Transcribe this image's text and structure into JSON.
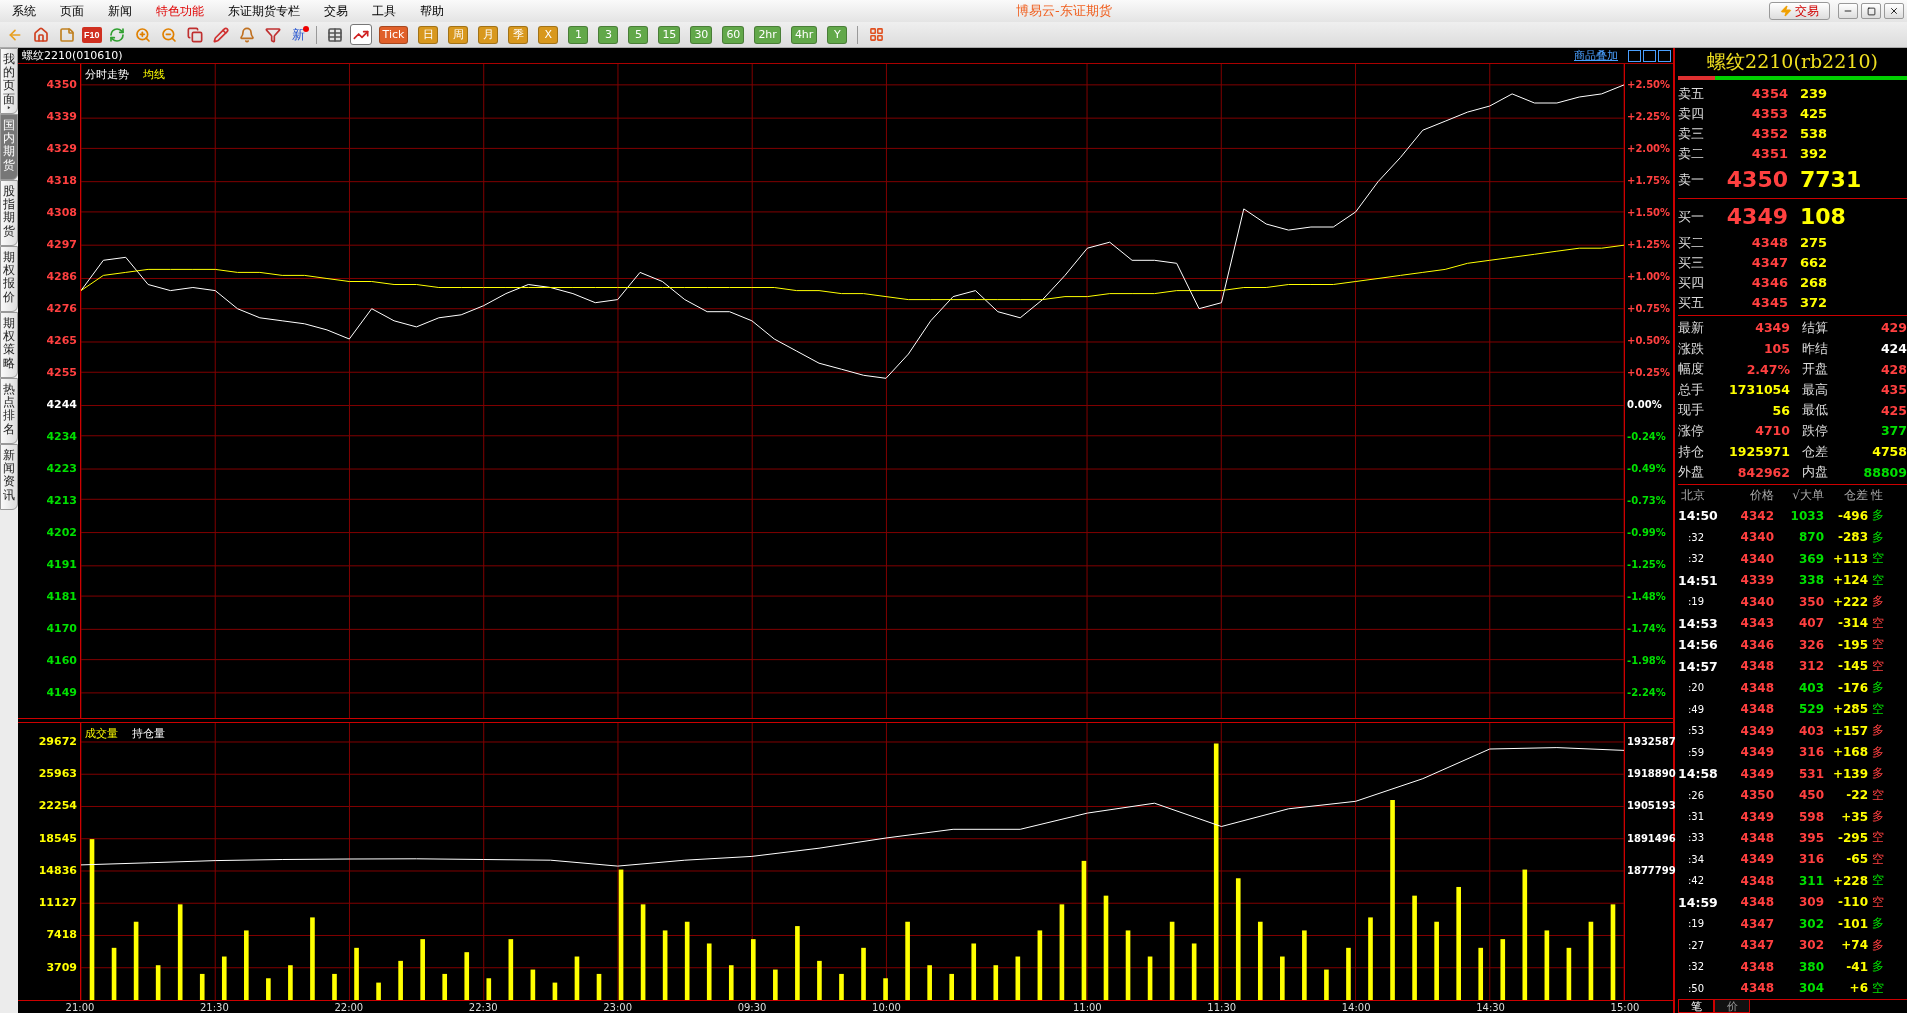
{
  "menu": [
    {
      "label": "系统",
      "highlighted": false
    },
    {
      "label": "页面",
      "highlighted": false
    },
    {
      "label": "新闻",
      "highlighted": false
    },
    {
      "label": "特色功能",
      "highlighted": true
    },
    {
      "label": "东证期货专栏",
      "highlighted": false
    },
    {
      "label": "交易",
      "highlighted": false
    },
    {
      "label": "工具",
      "highlighted": false
    },
    {
      "label": "帮助",
      "highlighted": false
    }
  ],
  "window": {
    "title": "博易云-东证期货",
    "trade_button": "交易"
  },
  "toolbar": {
    "f10": "F10",
    "news": "新",
    "views": [
      {
        "selected": false
      },
      {
        "selected": true
      }
    ],
    "periods": [
      {
        "label": "Tick",
        "color": "#e0602a"
      },
      {
        "label": "日",
        "color": "#d8981e"
      },
      {
        "label": "周",
        "color": "#d8981e"
      },
      {
        "label": "月",
        "color": "#d8981e"
      },
      {
        "label": "季",
        "color": "#d8981e"
      },
      {
        "label": "X",
        "color": "#d8981e"
      },
      {
        "label": "1",
        "color": "#62a84a"
      },
      {
        "label": "3",
        "color": "#62a84a"
      },
      {
        "label": "5",
        "color": "#62a84a"
      },
      {
        "label": "15",
        "color": "#62a84a"
      },
      {
        "label": "30",
        "color": "#62a84a"
      },
      {
        "label": "60",
        "color": "#62a84a"
      },
      {
        "label": "2hr",
        "color": "#62a84a"
      },
      {
        "label": "4hr",
        "color": "#62a84a"
      },
      {
        "label": "Y",
        "color": "#62a84a"
      }
    ]
  },
  "sidebar": {
    "items": [
      {
        "label": "我的页面",
        "selected": false,
        "has_arrow": true
      },
      {
        "label": "国内期货",
        "selected": true,
        "has_arrow": false
      },
      {
        "label": "股指期货",
        "selected": false,
        "has_arrow": false
      },
      {
        "label": "期权报价",
        "selected": false,
        "has_arrow": false
      },
      {
        "label": "期权策略",
        "selected": false,
        "has_arrow": false
      },
      {
        "label": "热点排名",
        "selected": false,
        "has_arrow": false
      },
      {
        "label": "新闻资讯",
        "selected": false,
        "has_arrow": false
      }
    ]
  },
  "chart_header": {
    "symbol": "螺纹2210(010610)",
    "overlay_link": "商品叠加"
  },
  "price_chart": {
    "chart_data": {
      "type": "line",
      "grid": true,
      "series": [
        {
          "name": "分时走势",
          "color": "#ffffff",
          "values": [
            4282,
            4292,
            4293,
            4284,
            4282,
            4283,
            4282,
            4276,
            4273,
            4272,
            4271,
            4269,
            4266,
            4276,
            4272,
            4270,
            4273,
            4274,
            4277,
            4281,
            4284,
            4283,
            4281,
            4278,
            4279,
            4288,
            4285,
            4279,
            4275,
            4275,
            4272,
            4266,
            4262,
            4258,
            4256,
            4254,
            4253,
            4261,
            4272,
            4280,
            4282,
            4275,
            4273,
            4279,
            4287,
            4296,
            4298,
            4292,
            4292,
            4291,
            4276,
            4278,
            4309,
            4304,
            4302,
            4303,
            4303,
            4308,
            4318,
            4326,
            4335,
            4338,
            4341,
            4343,
            4347,
            4344,
            4344,
            4346,
            4347,
            4350
          ]
        },
        {
          "name": "均线",
          "color": "#ffff00",
          "values": [
            4282,
            4287,
            4288,
            4289,
            4289,
            4289,
            4289,
            4288,
            4288,
            4287,
            4287,
            4286,
            4285,
            4285,
            4284,
            4284,
            4283,
            4283,
            4283,
            4283,
            4283,
            4283,
            4283,
            4283,
            4283,
            4283,
            4283,
            4283,
            4283,
            4283,
            4283,
            4283,
            4282,
            4282,
            4281,
            4281,
            4280,
            4279,
            4279,
            4279,
            4279,
            4279,
            4279,
            4279,
            4280,
            4280,
            4281,
            4281,
            4281,
            4282,
            4282,
            4282,
            4283,
            4283,
            4284,
            4284,
            4284,
            4285,
            4286,
            4287,
            4288,
            4289,
            4291,
            4292,
            4293,
            4294,
            4295,
            4296,
            4296,
            4297
          ]
        }
      ],
      "yticks": [
        4350,
        4339,
        4329,
        4318,
        4308,
        4297,
        4286,
        4276,
        4265,
        4255,
        4244,
        4234,
        4223,
        4213,
        4202,
        4191,
        4181,
        4170,
        4160,
        4149
      ],
      "ylim": [
        4140.7,
        4356.9
      ]
    },
    "time_labels": [
      "21:00",
      "21:30",
      "22:00",
      "22:30",
      "23:00",
      "09:30",
      "10:00",
      "11:00",
      "11:30",
      "14:00",
      "14:30",
      "15:00"
    ],
    "percent_labels": [
      {
        "text": "+2.50%",
        "color": "#ff4040"
      },
      {
        "text": "+2.25%",
        "color": "#ff4040"
      },
      {
        "text": "+2.00%",
        "color": "#ff4040"
      },
      {
        "text": "+1.75%",
        "color": "#ff4040"
      },
      {
        "text": "+1.50%",
        "color": "#ff4040"
      },
      {
        "text": "+1.25%",
        "color": "#ff4040"
      },
      {
        "text": "+1.00%",
        "color": "#ff4040"
      },
      {
        "text": "+0.75%",
        "color": "#ff4040"
      },
      {
        "text": "+0.50%",
        "color": "#ff4040"
      },
      {
        "text": "+0.25%",
        "color": "#ff4040"
      },
      {
        "text": "0.00%",
        "color": "#ffffff"
      },
      {
        "text": "-0.24%",
        "color": "#00e000"
      },
      {
        "text": "-0.49%",
        "color": "#00e000"
      },
      {
        "text": "-0.73%",
        "color": "#00e000"
      },
      {
        "text": "-0.99%",
        "color": "#00e000"
      },
      {
        "text": "-1.25%",
        "color": "#00e000"
      },
      {
        "text": "-1.48%",
        "color": "#00e000"
      },
      {
        "text": "-1.74%",
        "color": "#00e000"
      },
      {
        "text": "-1.98%",
        "color": "#00e000"
      },
      {
        "text": "-2.24%",
        "color": "#00e000"
      }
    ]
  },
  "volume_chart": {
    "chart_data": {
      "type": "bar",
      "grid": true,
      "series": [
        {
          "name": "成交量",
          "color": "#ffff00",
          "values": [
            18500,
            6000,
            9000,
            4000,
            11000,
            3000,
            5000,
            8000,
            2500,
            4000,
            9500,
            3000,
            6000,
            2000,
            4500,
            7000,
            3000,
            5500,
            2500,
            7000,
            3500,
            2000,
            5000,
            3000,
            15000,
            11000,
            8000,
            9000,
            6500,
            4000,
            7000,
            3500,
            8500,
            4500,
            3000,
            6000,
            2500,
            9000,
            4000,
            3000,
            6500,
            4000,
            5000,
            8000,
            11000,
            16000,
            12000,
            8000,
            5000,
            9000,
            6500,
            29500,
            14000,
            9000,
            5000,
            8000,
            3500,
            6000,
            9500,
            23000,
            12000,
            9000,
            13000,
            6000,
            7000,
            15000,
            8000,
            6000,
            9000,
            11000
          ]
        }
      ],
      "yticks": [
        29672,
        25963,
        22254,
        18545,
        14836,
        11127,
        7418,
        3709
      ],
      "ylim": [
        0,
        31857
      ]
    }
  },
  "open_interest_chart": {
    "chart_data": {
      "type": "line",
      "series": [
        {
          "name": "持仓量",
          "color": "#ffffff",
          "values": [
            1880400,
            1881300,
            1882200,
            1882700,
            1882900,
            1883000,
            1882700,
            1882400,
            1879900,
            1882400,
            1884000,
            1887500,
            1891800,
            1895500,
            1895500,
            1902400,
            1906600,
            1896700,
            1904200,
            1907400,
            1917000,
            1929600,
            1930200,
            1929000
          ]
        }
      ],
      "yticks": [
        1932587,
        1918890,
        1905193,
        1891496,
        1877799
      ],
      "ylim": [
        1823011,
        1940656
      ]
    }
  },
  "quote": {
    "title": "螺纹2210(rb2210)",
    "ratio_bar": {
      "level": 0.16
    },
    "asks": [
      {
        "label": "卖五",
        "price": "4354",
        "volume": "239",
        "best": false
      },
      {
        "label": "卖四",
        "price": "4353",
        "volume": "425",
        "best": false
      },
      {
        "label": "卖三",
        "price": "4352",
        "volume": "538",
        "best": false
      },
      {
        "label": "卖二",
        "price": "4351",
        "volume": "392",
        "best": false
      },
      {
        "label": "卖一",
        "price": "4350",
        "volume": "7731",
        "best": true
      }
    ],
    "bids": [
      {
        "label": "买一",
        "price": "4349",
        "volume": "108",
        "best": true
      },
      {
        "label": "买二",
        "price": "4348",
        "volume": "275",
        "best": false
      },
      {
        "label": "买三",
        "price": "4347",
        "volume": "662",
        "best": false
      },
      {
        "label": "买四",
        "price": "4346",
        "volume": "268",
        "best": false
      },
      {
        "label": "买五",
        "price": "4345",
        "volume": "372",
        "best": false
      }
    ],
    "stats": [
      {
        "label": "最新",
        "value": "4349",
        "color": "#ff4040"
      },
      {
        "label": "结算",
        "value": "429",
        "color": "#ff4040"
      },
      {
        "label": "涨跌",
        "value": "105",
        "color": "#ff4040"
      },
      {
        "label": "昨结",
        "value": "424",
        "color": "#ffffff"
      },
      {
        "label": "幅度",
        "value": "2.47%",
        "color": "#ff4040"
      },
      {
        "label": "开盘",
        "value": "428",
        "color": "#ff4040"
      },
      {
        "label": "总手",
        "value": "1731054",
        "color": "#ffff00"
      },
      {
        "label": "最高",
        "value": "435",
        "color": "#ff4040"
      },
      {
        "label": "现手",
        "value": "56",
        "color": "#ffff00"
      },
      {
        "label": "最低",
        "value": "425",
        "color": "#ff4040"
      },
      {
        "label": "涨停",
        "value": "4710",
        "color": "#ff4040"
      },
      {
        "label": "跌停",
        "value": "377",
        "color": "#00e000"
      },
      {
        "label": "持仓",
        "value": "1925971",
        "color": "#ffff00"
      },
      {
        "label": "仓差",
        "value": "4758",
        "color": "#ffff00"
      },
      {
        "label": "外盘",
        "value": "842962",
        "color": "#ff4040"
      },
      {
        "label": "内盘",
        "value": "88809",
        "color": "#00e000"
      }
    ]
  },
  "trades": {
    "columns": [
      "北京",
      "价格",
      "√大单",
      "仓差",
      "性"
    ],
    "rows": [
      {
        "kind": "full",
        "time": "14:50",
        "price": "4342",
        "volume": "1033",
        "oi_change": "-496",
        "nature": "多",
        "color": "#00e000"
      },
      {
        "kind": "sub",
        "time": ":32",
        "price": "4340",
        "volume": "870",
        "oi_change": "-283",
        "nature": "多",
        "color": "#00e000"
      },
      {
        "kind": "sub",
        "time": ":32",
        "price": "4340",
        "volume": "369",
        "oi_change": "+113",
        "nature": "空",
        "color": "#00e000"
      },
      {
        "kind": "full",
        "time": "14:51",
        "price": "4339",
        "volume": "338",
        "oi_change": "+124",
        "nature": "空",
        "color": "#00e000"
      },
      {
        "kind": "sub",
        "time": ":19",
        "price": "4340",
        "volume": "350",
        "oi_change": "+222",
        "nature": "多",
        "color": "#ff4040"
      },
      {
        "kind": "full",
        "time": "14:53",
        "price": "4343",
        "volume": "407",
        "oi_change": "-314",
        "nature": "空",
        "color": "#ff4040"
      },
      {
        "kind": "full",
        "time": "14:56",
        "price": "4346",
        "volume": "326",
        "oi_change": "-195",
        "nature": "空",
        "color": "#ff4040"
      },
      {
        "kind": "full",
        "time": "14:57",
        "price": "4348",
        "volume": "312",
        "oi_change": "-145",
        "nature": "空",
        "color": "#ff4040"
      },
      {
        "kind": "sub",
        "time": ":20",
        "price": "4348",
        "volume": "403",
        "oi_change": "-176",
        "nature": "多",
        "color": "#00e000"
      },
      {
        "kind": "sub",
        "time": ":49",
        "price": "4348",
        "volume": "529",
        "oi_change": "+285",
        "nature": "空",
        "color": "#00e000"
      },
      {
        "kind": "sub",
        "time": ":53",
        "price": "4349",
        "volume": "403",
        "oi_change": "+157",
        "nature": "多",
        "color": "#ff4040"
      },
      {
        "kind": "sub",
        "time": ":59",
        "price": "4349",
        "volume": "316",
        "oi_change": "+168",
        "nature": "多",
        "color": "#ff4040"
      },
      {
        "kind": "full",
        "time": "14:58",
        "price": "4349",
        "volume": "531",
        "oi_change": "+139",
        "nature": "多",
        "color": "#ff4040"
      },
      {
        "kind": "sub",
        "time": ":26",
        "price": "4350",
        "volume": "450",
        "oi_change": "-22",
        "nature": "空",
        "color": "#ff4040"
      },
      {
        "kind": "sub",
        "time": ":31",
        "price": "4349",
        "volume": "598",
        "oi_change": "+35",
        "nature": "多",
        "color": "#ff4040"
      },
      {
        "kind": "sub",
        "time": ":33",
        "price": "4348",
        "volume": "395",
        "oi_change": "-295",
        "nature": "空",
        "color": "#ff4040"
      },
      {
        "kind": "sub",
        "time": ":34",
        "price": "4349",
        "volume": "316",
        "oi_change": "-65",
        "nature": "空",
        "color": "#ff4040"
      },
      {
        "kind": "sub",
        "time": ":42",
        "price": "4348",
        "volume": "311",
        "oi_change": "+228",
        "nature": "空",
        "color": "#00e000"
      },
      {
        "kind": "full",
        "time": "14:59",
        "price": "4348",
        "volume": "309",
        "oi_change": "-110",
        "nature": "空",
        "color": "#ff4040"
      },
      {
        "kind": "sub",
        "time": ":19",
        "price": "4347",
        "volume": "302",
        "oi_change": "-101",
        "nature": "多",
        "color": "#00e000"
      },
      {
        "kind": "sub",
        "time": ":27",
        "price": "4347",
        "volume": "302",
        "oi_change": "+74",
        "nature": "多",
        "color": "#ff4040"
      },
      {
        "kind": "sub",
        "time": ":32",
        "price": "4348",
        "volume": "380",
        "oi_change": "-41",
        "nature": "多",
        "color": "#00e000"
      },
      {
        "kind": "sub",
        "time": ":50",
        "price": "4348",
        "volume": "304",
        "oi_change": "+6",
        "nature": "空",
        "color": "#00e000"
      }
    ],
    "tabs": [
      {
        "label": "笔",
        "selected": true
      },
      {
        "label": "价",
        "selected": false
      }
    ]
  }
}
